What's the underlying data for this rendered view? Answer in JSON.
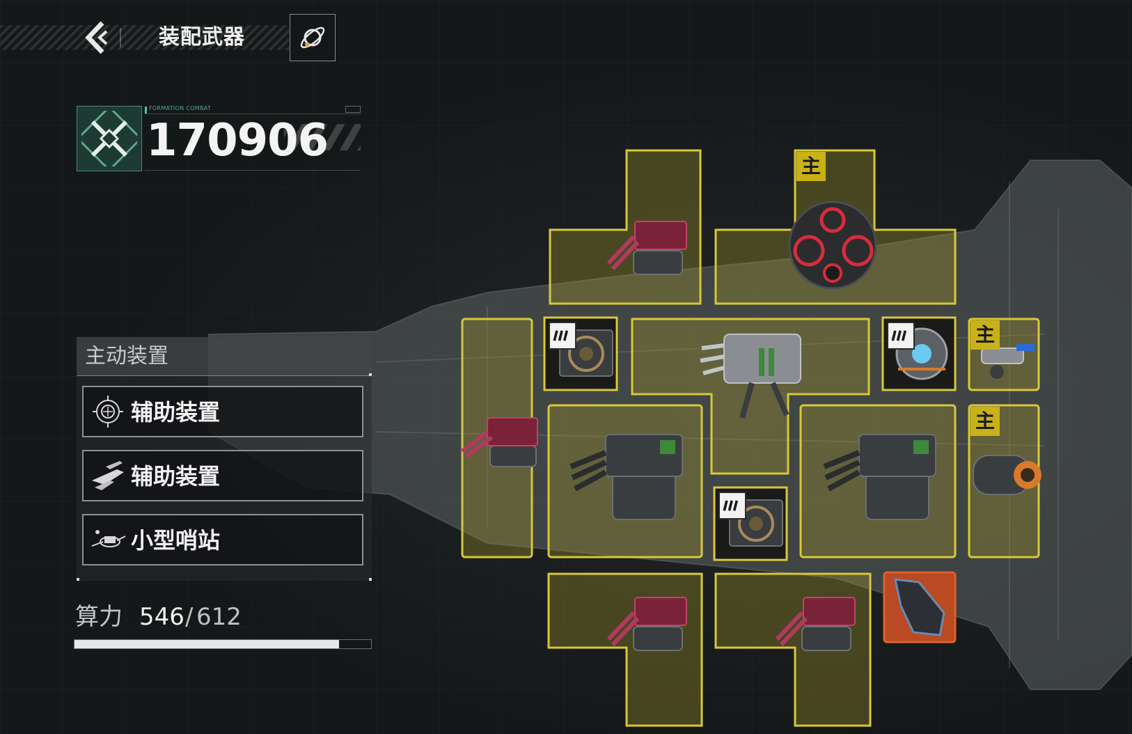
{
  "header": {
    "title": "装配武器"
  },
  "combat_power": {
    "label": "FORMATION COMBAT",
    "value": "170906"
  },
  "active_devices": {
    "title": "主动装置",
    "items": [
      {
        "label": "辅助装置",
        "icon": "shield-orb-icon"
      },
      {
        "label": "辅助装置",
        "icon": "fighter-squadron-icon"
      },
      {
        "label": "小型哨站",
        "icon": "outpost-icon"
      }
    ]
  },
  "compute": {
    "label": "算力",
    "used": "546",
    "separator": "/",
    "total": "612",
    "fraction": 0.892
  },
  "slots": {
    "main_badge": "主",
    "items": [
      {
        "name": "slot-turret-top-left",
        "item": "red-cannon-turret"
      },
      {
        "name": "slot-core-top",
        "item": "spherical-reactor-core",
        "main": true
      },
      {
        "name": "slot-turret-left-tall",
        "item": "red-cannon-turret"
      },
      {
        "name": "slot-module-small-1",
        "item": "energy-module",
        "energy": true
      },
      {
        "name": "slot-gatling-center",
        "item": "gatling-cannon"
      },
      {
        "name": "slot-module-small-2",
        "item": "sphere-drone",
        "energy": true
      },
      {
        "name": "slot-right-top",
        "item": "small-thruster",
        "main": true
      },
      {
        "name": "slot-missile-left",
        "item": "missile-launcher"
      },
      {
        "name": "slot-module-small-3",
        "item": "energy-module",
        "energy": true
      },
      {
        "name": "slot-missile-right",
        "item": "missile-launcher"
      },
      {
        "name": "slot-right-bottom",
        "item": "cylinder-engine",
        "main": true
      },
      {
        "name": "slot-turret-bottom-left",
        "item": "red-cannon-turret"
      },
      {
        "name": "slot-turret-bottom-right",
        "item": "red-cannon-turret"
      },
      {
        "name": "slot-unique-orange",
        "item": "armor-plate"
      }
    ]
  },
  "colors": {
    "slot_border": "#d8c83a",
    "slot_fill": "#6b6a2c",
    "main_badge": "#c9b118",
    "unique_slot": "#d5542a",
    "accent_green": "#56c8a8"
  }
}
